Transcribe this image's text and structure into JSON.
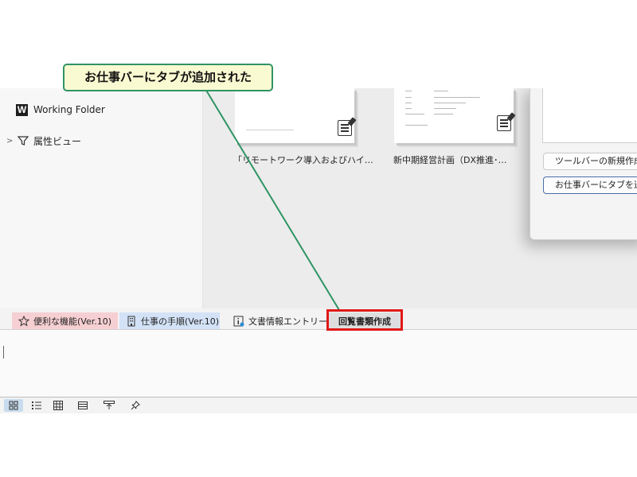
{
  "sidebar": {
    "items": [
      {
        "label": "Working Folder",
        "icon": "word-logo-icon"
      },
      {
        "label": "属性ビュー",
        "icon": "filter-icon"
      }
    ]
  },
  "documents": [
    {
      "label": "「リモートワーク導入およびハイ…",
      "icon": "note-edit-icon"
    },
    {
      "label": "新中期経営計画（DX推進･…",
      "icon": "note-edit-icon"
    }
  ],
  "dialog": {
    "buttons": [
      {
        "label": "ツールバーの新規作成"
      },
      {
        "label": "お仕事バーにタブを追加"
      }
    ]
  },
  "tabs": [
    {
      "label": "便利な機能(Ver.10)",
      "icon": "star-icon",
      "color": "#f6cfd2"
    },
    {
      "label": "仕事の手順(Ver.10)",
      "icon": "building-icon",
      "color": "#d3e2f6"
    },
    {
      "label": "文書情報エントリー",
      "icon": "info-icon",
      "color": "#f3f3f3"
    },
    {
      "label": "回覧書類作成",
      "icon": "",
      "color": "#dedede",
      "active": true
    }
  ],
  "status_bar": {
    "icons": [
      "grid-view-icon",
      "list-view-icon",
      "table-view-icon",
      "detail-view-icon",
      "export-icon",
      "pin-icon"
    ]
  },
  "annotation": {
    "callout_text": "お仕事バーにタブが追加された",
    "accent": "#2f9464",
    "highlight_color": "#e01818"
  }
}
